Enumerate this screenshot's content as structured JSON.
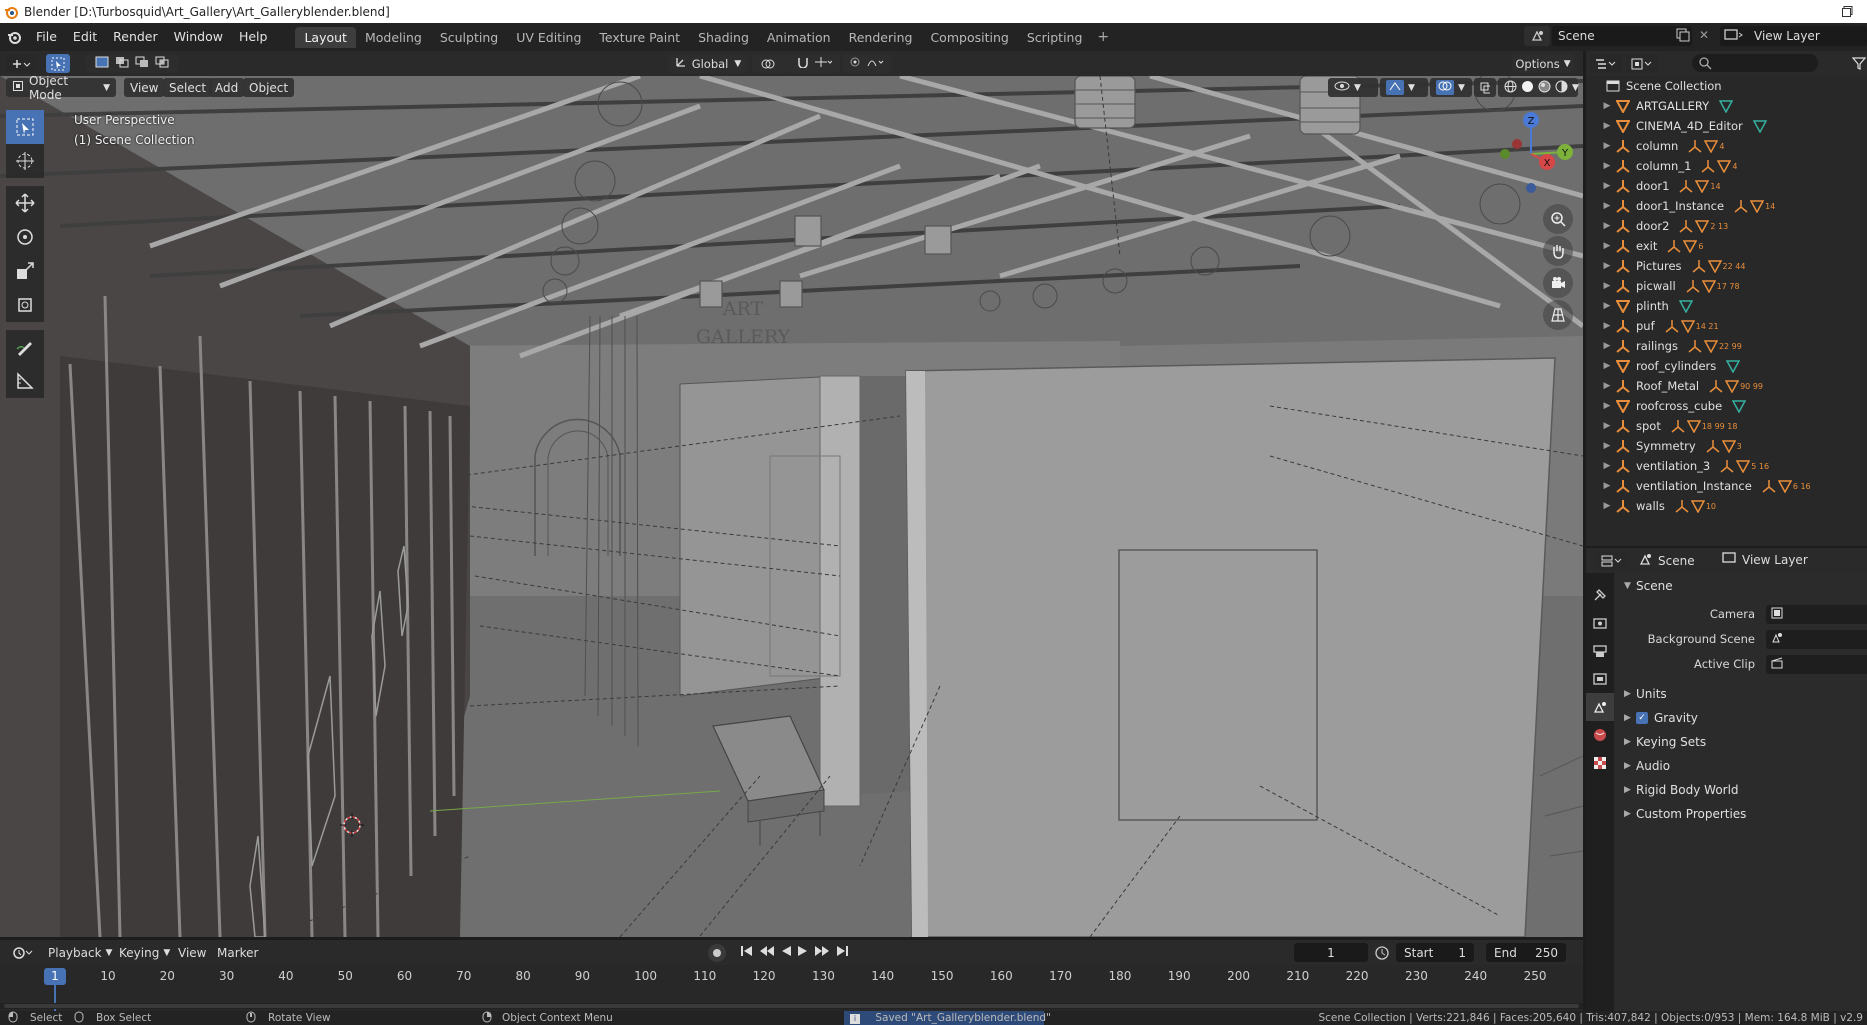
{
  "window": {
    "title": "Blender [D:\\Turbosquid\\Art_Gallery\\Art_Galleryblender.blend]",
    "maximize_icon": "restore-icon"
  },
  "menubar": {
    "items": [
      "File",
      "Edit",
      "Render",
      "Window",
      "Help"
    ],
    "workspaces": [
      "Layout",
      "Modeling",
      "Sculpting",
      "UV Editing",
      "Texture Paint",
      "Shading",
      "Animation",
      "Rendering",
      "Compositing",
      "Scripting"
    ],
    "active_workspace": "Layout",
    "add_label": "+",
    "scene": "Scene",
    "view_layer": "View Layer"
  },
  "toolheader": {
    "orientation": "Global",
    "options": "Options"
  },
  "viewport": {
    "mode": "Object Mode",
    "menus": [
      "View",
      "Select",
      "Add",
      "Object"
    ],
    "perspective": "User Perspective",
    "collection": "(1) Scene Collection",
    "sign_line1": "ART",
    "sign_line2": "GALLERY",
    "axis_x": "X",
    "axis_y": "Y",
    "axis_z": "Z"
  },
  "outliner": {
    "root": "Scene Collection",
    "items": [
      {
        "name": "ARTGALLERY",
        "extra": ""
      },
      {
        "name": "CINEMA_4D_Editor",
        "extra": ""
      },
      {
        "name": "column",
        "extra": "4"
      },
      {
        "name": "column_1",
        "extra": "4"
      },
      {
        "name": "door1",
        "extra": "14"
      },
      {
        "name": "door1_Instance",
        "extra": "14"
      },
      {
        "name": "door2",
        "extra": "2 13"
      },
      {
        "name": "exit",
        "extra": "6"
      },
      {
        "name": "Pictures",
        "extra": "22 44"
      },
      {
        "name": "picwall",
        "extra": "17 78"
      },
      {
        "name": "plinth",
        "extra": ""
      },
      {
        "name": "puf",
        "extra": "14 21"
      },
      {
        "name": "railings",
        "extra": "22 99"
      },
      {
        "name": "roof_cylinders",
        "extra": ""
      },
      {
        "name": "Roof_Metal",
        "extra": "90 99"
      },
      {
        "name": "roofcross_cube",
        "extra": ""
      },
      {
        "name": "spot",
        "extra": "18 99 18"
      },
      {
        "name": "Symmetry",
        "extra": "3"
      },
      {
        "name": "ventilation_3",
        "extra": "5 16"
      },
      {
        "name": "ventilation_Instance",
        "extra": "6 16"
      },
      {
        "name": "walls",
        "extra": "10"
      }
    ]
  },
  "properties": {
    "header_scene": "Scene",
    "header_view_layer": "View Layer",
    "section": "Scene",
    "camera_label": "Camera",
    "background_label": "Background Scene",
    "clip_label": "Active Clip",
    "panels": [
      "Units",
      "Gravity",
      "Keying Sets",
      "Audio",
      "Rigid Body World",
      "Custom Properties"
    ]
  },
  "timeline": {
    "menus": [
      "Playback",
      "Keying",
      "View",
      "Marker"
    ],
    "current_frame": "1",
    "start_label": "Start",
    "start": "1",
    "end_label": "End",
    "end": "250",
    "ticks": [
      "10",
      "20",
      "30",
      "40",
      "50",
      "60",
      "70",
      "80",
      "90",
      "100",
      "110",
      "120",
      "130",
      "140",
      "150",
      "160",
      "170",
      "180",
      "190",
      "200",
      "210",
      "220",
      "230",
      "240",
      "250"
    ],
    "cursor_frame": "1"
  },
  "statusbar": {
    "select": "Select",
    "box_select": "Box Select",
    "rotate": "Rotate View",
    "context_menu": "Object Context Menu",
    "saved": "Saved \"Art_Galleryblender.blend\"",
    "stats": "Scene Collection | Verts:221,846 | Faces:205,640 | Tris:407,842 | Objects:0/953 | Mem: 164.8 MiB | v2.9"
  },
  "colors": {
    "accent": "#4772b3",
    "object_orange": "#e98e3a",
    "data_teal": "#34b1a0"
  }
}
